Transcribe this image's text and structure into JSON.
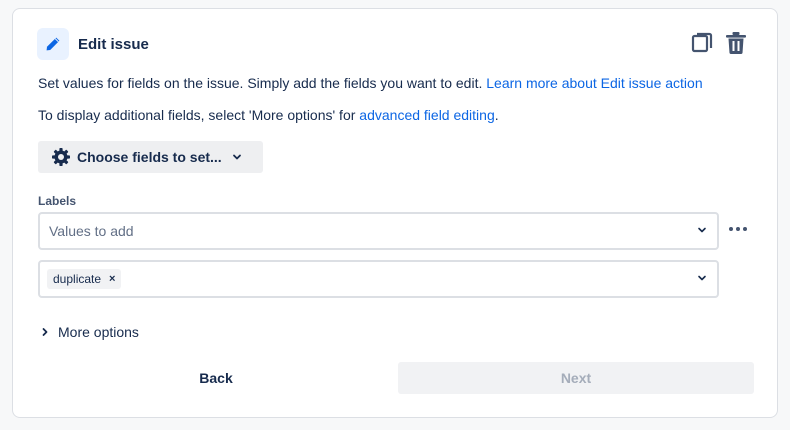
{
  "header": {
    "title": "Edit issue",
    "icons": [
      "pencil-icon",
      "copy-icon",
      "trash-icon"
    ],
    "accent_color": "#0c66e4"
  },
  "description": {
    "line1_text": "Set values for fields on the issue. Simply add the fields you want to edit. ",
    "line1_link": "Learn more about Edit issue action",
    "line2_text": "To display additional fields, select 'More options' for ",
    "line2_link": "advanced field editing",
    "line2_suffix": "."
  },
  "choose_fields": {
    "label": "Choose fields to set...",
    "icons": [
      "gear-icon",
      "chevron-down-icon"
    ]
  },
  "labels_field": {
    "label": "Labels",
    "mode_select": {
      "placeholder": "Values to add"
    },
    "values": [
      "duplicate"
    ],
    "remove_glyph": "×"
  },
  "more_options": {
    "label": "More options"
  },
  "footer": {
    "back_label": "Back",
    "next_label": "Next"
  },
  "colors": {
    "link": "#0c66e4",
    "text": "#172b4d",
    "disabled_text": "#a5adba",
    "border": "#dcdfe4"
  }
}
